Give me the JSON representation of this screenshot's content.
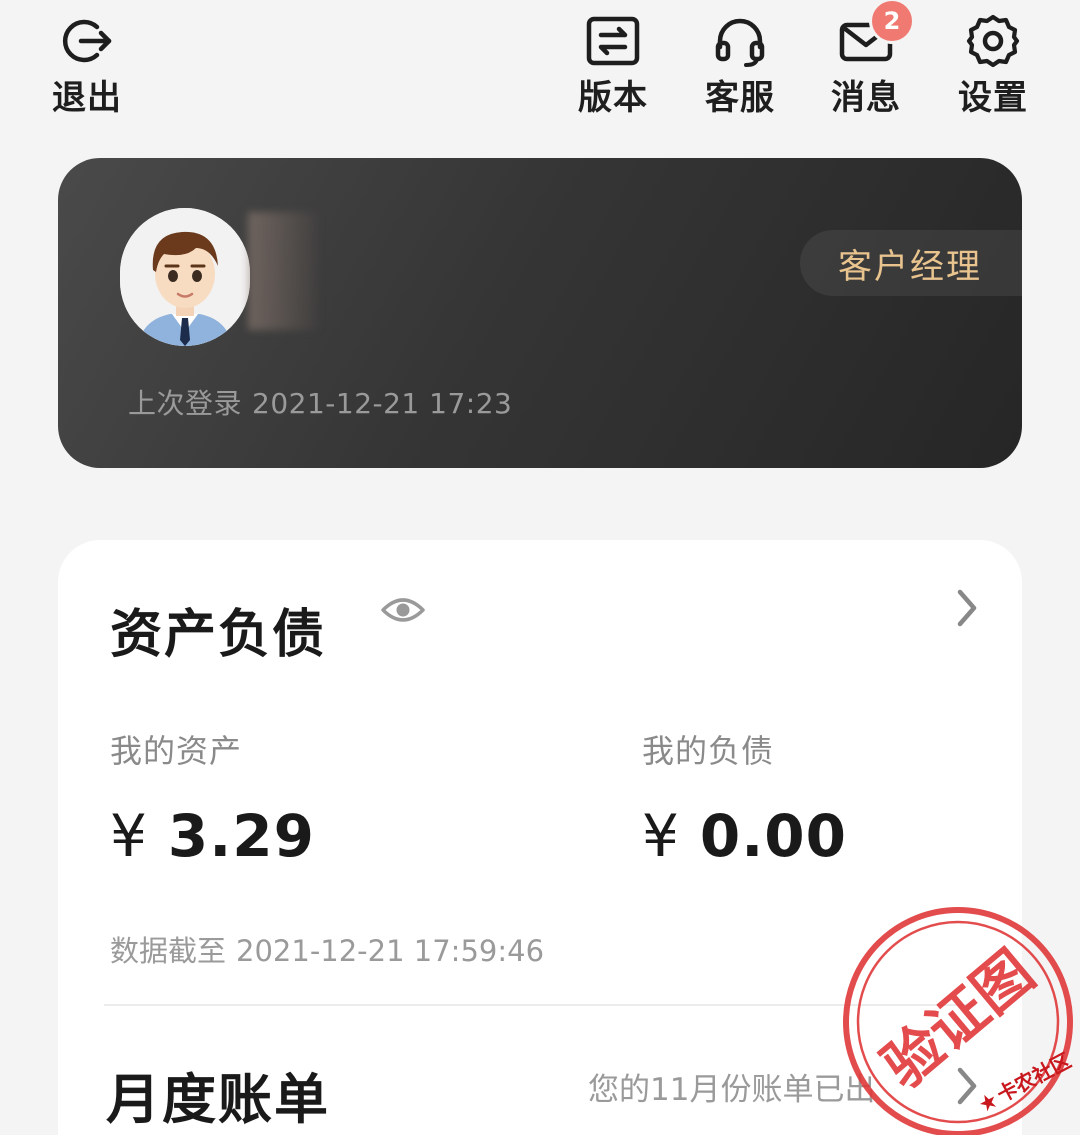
{
  "header": {
    "logout_label": "退出",
    "version_label": "版本",
    "service_label": "客服",
    "messages_label": "消息",
    "messages_badge": "2",
    "settings_label": "设置"
  },
  "profile": {
    "manager_label": "客户经理",
    "last_login_label": "上次登录",
    "last_login_time": "2021-12-21 17:23"
  },
  "assets": {
    "title": "资产负债",
    "my_assets_label": "我的资产",
    "my_assets_currency": "¥",
    "my_assets_value": "3.29",
    "my_debts_label": "我的负债",
    "my_debts_currency": "¥",
    "my_debts_value": "0.00",
    "data_time_label": "数据截至",
    "data_time": "2021-12-21 17:59:46"
  },
  "monthly_bill": {
    "title": "月度账单",
    "note": "您的11月份账单已出"
  },
  "watermark": {
    "stamp_text": "验证图",
    "site_text": "卡农社区"
  },
  "colors": {
    "accent_gold": "#e9c48e",
    "badge_red": "#f07a72",
    "card_dark": "#2f2f2f",
    "stamp_red": "#e0383a"
  }
}
